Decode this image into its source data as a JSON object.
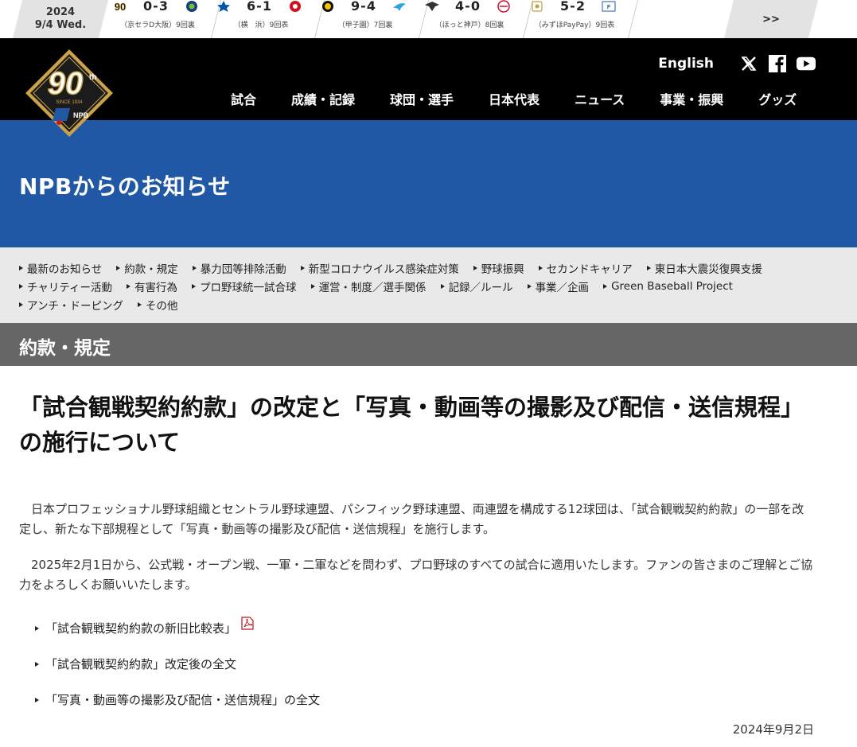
{
  "ticker": {
    "year": "2024",
    "day": "9/4 Wed.",
    "more": ">>",
    "games": [
      {
        "home_icon": "90th-logo-icon",
        "away_icon": "lions-logo-icon",
        "score": "0-3",
        "venue": "（京セラD大阪）9回裏",
        "home_color": "#000000",
        "away_color": "#1a3e7a"
      },
      {
        "home_icon": "baystars-logo-icon",
        "away_icon": "carp-logo-icon",
        "score": "6-1",
        "venue": "（横　浜）9回表",
        "home_color": "#0055a5",
        "away_color": "#d2111f"
      },
      {
        "home_icon": "tigers-logo-icon",
        "away_icon": "swallows-logo-icon",
        "score": "9-4",
        "venue": "（甲子園）7回裏",
        "home_color": "#111111",
        "away_color": "#2aa7df"
      },
      {
        "home_icon": "eagles-logo-icon",
        "away_icon": "marines-logo-icon",
        "score": "4-0",
        "venue": "（ほっと神戸）8回裏",
        "home_color": "#333333",
        "away_color": "#c8102e"
      },
      {
        "home_icon": "hawks-logo-icon",
        "away_icon": "fighters-logo-icon",
        "score": "5-2",
        "venue": "（みずほPayPay）9回表",
        "home_color": "#b8a046",
        "away_color": "#1e5aa8"
      }
    ]
  },
  "header": {
    "logo_icon": "npb-90th-logo-icon",
    "english": "English",
    "social": [
      "x-icon",
      "facebook-icon",
      "youtube-icon"
    ],
    "nav": [
      "試合",
      "成績・記録",
      "球団・選手",
      "日本代表",
      "ニュース",
      "事業・振興",
      "グッズ"
    ]
  },
  "banner": {
    "title": "NPBからのお知らせ"
  },
  "categories": {
    "row1": [
      "最新のお知らせ",
      "約款・規定",
      "暴力団等排除活動",
      "新型コロナウイルス感染症対策",
      "野球振興",
      "セカンドキャリア",
      "東日本大震災復興支援"
    ],
    "row2": [
      "チャリティー活動",
      "有害行為",
      "プロ野球統一試合球",
      "運営・制度／選手関係",
      "記録／ルール",
      "事業／企画",
      "Green Baseball Project"
    ],
    "row3": [
      "アンチ・ドーピング",
      "その他"
    ]
  },
  "section": {
    "title": "約款・規定"
  },
  "article": {
    "title": "「試合観戦契約約款」の改定と「写真・動画等の撮影及び配信・送信規程」の施行について",
    "paragraph1": "日本プロフェッショナル野球組織とセントラル野球連盟、パシフィック野球連盟、両連盟を構成する12球団は、「試合観戦契約約款」の一部を改定し、新たな下部規程として「写真・動画等の撮影及び配信・送信規程」を施行します。",
    "paragraph2": "2025年2月1日から、公式戦・オープン戦、一軍・二軍などを問わず、プロ野球のすべての試合に適用いたします。ファンの皆さまのご理解とご協力をよろしくお願いいたします。",
    "links": [
      "「試合観戦契約約款の新旧比較表」",
      "「試合観戦契約約款」改定後の全文",
      "「写真・動画等の撮影及び配信・送信規程」の全文"
    ],
    "pdf_icon": "pdf-icon",
    "date": "2024年9月2日"
  },
  "colors": {
    "banner": "#2158a6",
    "header": "#000000",
    "menu_bg": "#e9e9e9",
    "section_bar": "#666666",
    "gold": "#c9a24a"
  }
}
